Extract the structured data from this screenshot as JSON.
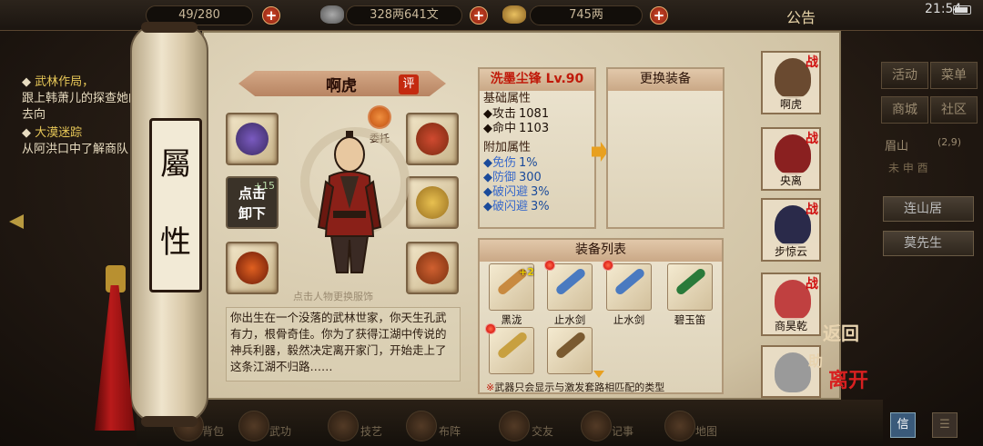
{
  "topbar": {
    "storage": "49/280",
    "money": "328两641文",
    "gold": "745两",
    "announce": "公告",
    "clock": "21:54"
  },
  "left_quests": [
    {
      "title": "武林作局，",
      "desc": "跟上韩萧儿的探查她的去向"
    },
    {
      "title": "大漠迷踪",
      "desc": "从阿洪口中了解商队"
    }
  ],
  "scroll_tab": {
    "char1": "屬",
    "char2": "性"
  },
  "character": {
    "name": "啊虎",
    "rate_label": "评",
    "entrust_label": "委托",
    "unload_label_1": "点击",
    "unload_label_2": "卸下",
    "unload_level": "+15",
    "hint": "点击人物更换服饰",
    "bio": "你出生在一个没落的武林世家，你天生孔武有力，根骨奇佳。你为了获得江湖中传说的神兵利器，毅然决定离开家门，开始走上了这条江湖不归路……"
  },
  "equip_panel": {
    "title": "洗墨尘锋 Lv.90",
    "base_header": "基础属性",
    "base_stats": [
      {
        "name": "攻击",
        "value": "1081"
      },
      {
        "name": "命中",
        "value": "1103"
      }
    ],
    "extra_header": "附加属性",
    "extra_stats": [
      {
        "name": "免伤",
        "value": "1%"
      },
      {
        "name": "防御",
        "value": "300"
      },
      {
        "name": "破闪避",
        "value": "3%"
      },
      {
        "name": "破闪避",
        "value": "3%"
      }
    ]
  },
  "change_panel": {
    "title": "更换装备"
  },
  "equip_list": {
    "title": "装备列表",
    "items": [
      {
        "name": "黑泷",
        "badge": "+2",
        "dot": false,
        "color": "#c88a40"
      },
      {
        "name": "止水剑",
        "badge": "",
        "dot": true,
        "color": "#4a7ac0"
      },
      {
        "name": "止水剑",
        "badge": "",
        "dot": true,
        "color": "#4a7ac0"
      },
      {
        "name": "碧玉笛",
        "badge": "",
        "dot": false,
        "color": "#2a7a3a"
      },
      {
        "name": "",
        "badge": "",
        "dot": true,
        "color": "#c8a040"
      },
      {
        "name": "",
        "badge": "",
        "dot": false,
        "color": "#7a5a30"
      }
    ],
    "note_mark": "※",
    "note": "武器只会显示与激发套路相匹配的类型"
  },
  "team": [
    {
      "name": "啊虎",
      "tag": "战",
      "color": "#6a4a30"
    },
    {
      "name": "央离",
      "tag": "战",
      "color": "#8a2020"
    },
    {
      "name": "步惊云",
      "tag": "战",
      "color": "#2a2a4a"
    },
    {
      "name": "商昊乾",
      "tag": "战",
      "color": "#c04040"
    },
    {
      "name": "",
      "tag": "",
      "color": "#9a9a9a"
    }
  ],
  "side_actions": {
    "back": "返回",
    "assist": "助",
    "leave": "离开"
  },
  "right_menu": {
    "buttons": [
      "活动",
      "菜单",
      "商城",
      "社区"
    ],
    "location": "眉山",
    "coords": "(2,9)",
    "time_row": "未 申 酉",
    "places": [
      "连山居",
      "莫先生"
    ],
    "mail": "信"
  },
  "bottom_bar": [
    "背包",
    "武功",
    "技艺",
    "布阵",
    "交友",
    "记事",
    "地图"
  ]
}
